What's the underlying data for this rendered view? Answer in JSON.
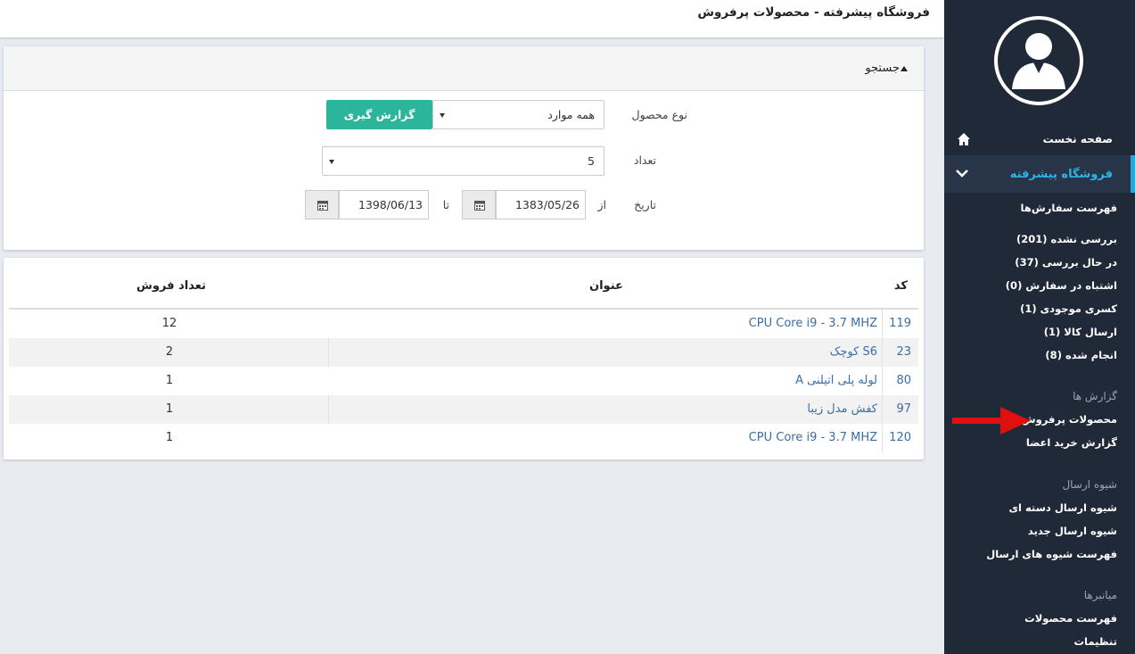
{
  "header": {
    "title": "فروشگاه پیشرفته - محصولات پرفروش"
  },
  "sidebar": {
    "home_label": "صفحه نخست",
    "shop_label": "فروشگاه پیشرفته",
    "orders_list": "فهرست سفارش‌ها",
    "order_items": [
      "بررسی نشده (201)",
      "در حال بررسی (37)",
      "اشتباه در سفارش (0)",
      "کسری موجودی (1)",
      "ارسال کالا (1)",
      "انجام شده (8)"
    ],
    "reports_heading": "گزارش ها",
    "report_items": [
      "محصولات پرفروش",
      "گزارش خرید اعضا"
    ],
    "shipping_heading": "شیوه ارسال",
    "shipping_items": [
      "شیوه ارسال دسته ای",
      "شیوه ارسال جدید",
      "فهرست شیوه های ارسال"
    ],
    "shortcuts_heading": "میانبرها",
    "shortcut_items": [
      "فهرست محصولات",
      "تنظیمات"
    ]
  },
  "search": {
    "title": "جستجو",
    "product_type_label": "نوع محصول",
    "product_type_value": "همه موارد",
    "report_button": "گزارش گیری",
    "count_label": "تعداد",
    "count_value": "5",
    "date_label": "تاریخ",
    "from_label": "از",
    "from_value": "1383/05/26",
    "to_label": "تا",
    "to_value": "1398/06/13"
  },
  "table": {
    "headers": {
      "code": "کد",
      "title": "عنوان",
      "sales": "تعداد فروش"
    },
    "rows": [
      {
        "code": "119",
        "title": "CPU Core i9 - 3.7 MHZ",
        "sales": "12"
      },
      {
        "code": "23",
        "title": "S6 کوچک",
        "sales": "2"
      },
      {
        "code": "80",
        "title": "لوله پلی اتیلنی A",
        "sales": "1"
      },
      {
        "code": "97",
        "title": "کفش مدل زیبا",
        "sales": "1"
      },
      {
        "code": "120",
        "title": "CPU Core i9 - 3.7 MHZ",
        "sales": "1"
      }
    ]
  },
  "colors": {
    "sidebar_bg": "#1f2937",
    "accent_blue": "#2fb3e8",
    "button_green": "#2bb59a",
    "link_blue": "#3a6ea5",
    "annotation_red": "#e01010"
  }
}
